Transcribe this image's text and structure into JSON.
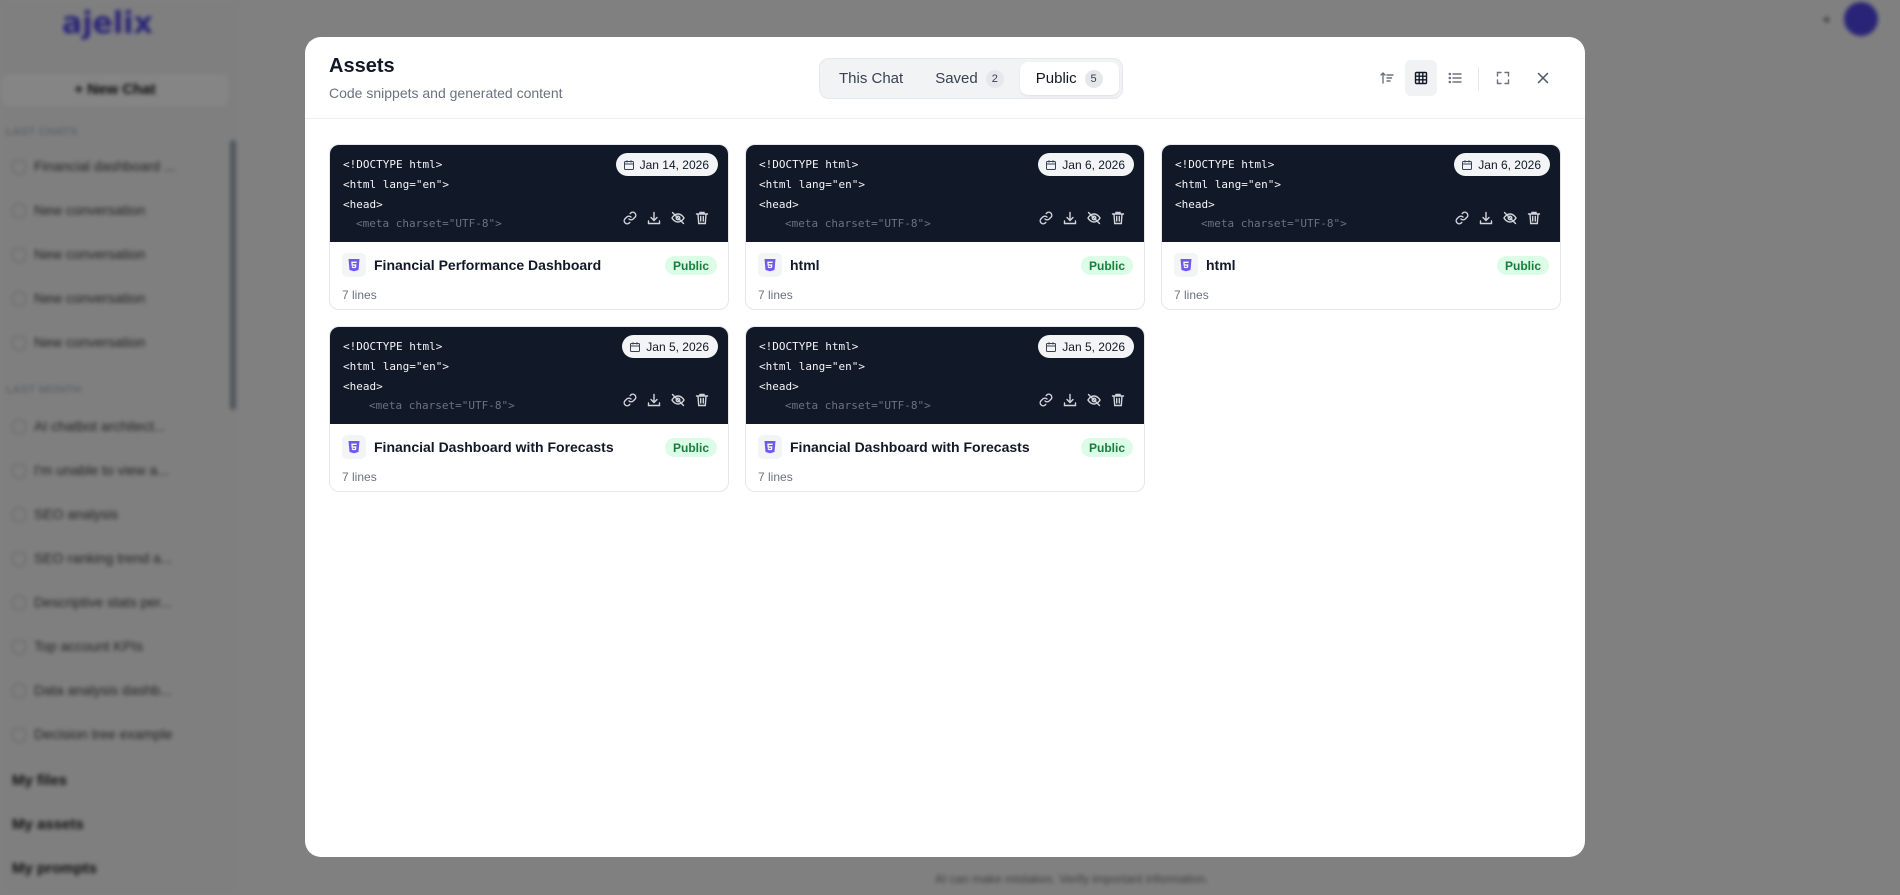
{
  "background": {
    "logo": "ajelix",
    "new_chat": "+ New Chat",
    "section_a": "LAST CHATS",
    "chats": [
      "Financial dashboard ...",
      "New conversation",
      "New conversation",
      "New conversation",
      "New conversation"
    ],
    "section_b": "LAST MONTH",
    "older": [
      "AI chatbot architect...",
      "I'm unable to view a...",
      "SEO analysis",
      "SEO ranking trend a...",
      "Descriptive stats per...",
      "Top account KPIs",
      "Data analysis dashb...",
      "Decision tree example"
    ],
    "footer": [
      "My files",
      "My assets",
      "My prompts"
    ],
    "footnote": "AI can make mistakes. Verify important information."
  },
  "modal": {
    "title": "Assets",
    "subtitle": "Code snippets and generated content",
    "tabs": [
      {
        "label": "This Chat",
        "count": ""
      },
      {
        "label": "Saved",
        "count": "2"
      },
      {
        "label": "Public",
        "count": "5"
      }
    ],
    "active_tab": "Public",
    "view_mode": "grid"
  },
  "code_preview": {
    "line1": "<!DOCTYPE html>",
    "line2": "<html lang=\"en\">",
    "line3": "<head>",
    "line4": "<meta charset=\"UTF-8\">"
  },
  "assets": [
    {
      "title": "Financial Performance Dashboard",
      "date": "Jan 14, 2026",
      "badge": "Public",
      "meta": "7 lines"
    },
    {
      "title": "html",
      "date": "Jan 6, 2026",
      "badge": "Public",
      "meta": "7 lines"
    },
    {
      "title": "html",
      "date": "Jan 6, 2026",
      "badge": "Public",
      "meta": "7 lines"
    },
    {
      "title": "Financial Dashboard with Forecasts",
      "date": "Jan 5, 2026",
      "badge": "Public",
      "meta": "7 lines"
    },
    {
      "title": "Financial Dashboard with Forecasts",
      "date": "Jan 5, 2026",
      "badge": "Public",
      "meta": "7 lines"
    }
  ],
  "colors": {
    "code_bg": "#111827",
    "public_badge_bg": "#dcfce7",
    "public_badge_text": "#15803d",
    "html_icon": "#6d5ae6"
  },
  "icons": [
    "sort-icon",
    "grid-view-icon",
    "list-view-icon",
    "fullscreen-icon",
    "close-icon",
    "calendar-icon",
    "link-icon",
    "download-icon",
    "eye-off-icon",
    "trash-icon",
    "html5-icon"
  ]
}
